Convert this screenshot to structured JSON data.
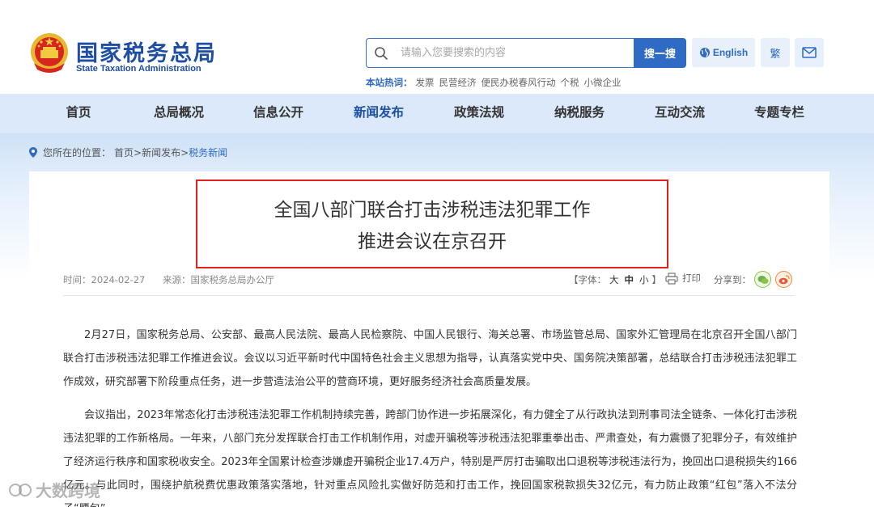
{
  "header": {
    "logo_cn": "国家税务总局",
    "logo_en": "State Taxation Administration",
    "search": {
      "placeholder": "请输入您要搜索的内容",
      "button": "搜一搜"
    },
    "english": "English",
    "traditional": "繁",
    "hot_label": "本站热词：",
    "hot_words": [
      "发票",
      "民营经济",
      "便民办税春风行动",
      "个税",
      "小微企业"
    ]
  },
  "nav": {
    "items": [
      "首页",
      "总局概况",
      "信息公开",
      "新闻发布",
      "政策法规",
      "纳税服务",
      "互动交流",
      "专题专栏"
    ],
    "active": "新闻发布"
  },
  "breadcrumb": {
    "label": "您所在的位置：",
    "items": [
      "首页",
      "新闻发布"
    ],
    "separator": ">",
    "current": "税务新闻"
  },
  "article": {
    "title_line1": "全国八部门联合打击涉税违法犯罪工作",
    "title_line2": "推进会议在京召开",
    "time": "时间：2024-02-27",
    "source": "来源：国家税务总局办公厅",
    "font_label": "【字体：",
    "font_large": "大",
    "font_medium": "中",
    "font_small": "小",
    "font_close": "】",
    "print": "打印",
    "share": "分享到：",
    "paragraphs": [
      "2月27日，国家税务总局、公安部、最高人民法院、最高人民检察院、中国人民银行、海关总署、市场监管总局、国家外汇管理局在北京召开全国八部门联合打击涉税违法犯罪工作推进会议。会议以习近平新时代中国特色社会主义思想为指导，认真落实党中央、国务院决策部署，总结联合打击涉税违法犯罪工作成效，研究部署下阶段重点任务，进一步营造法治公平的营商环境，更好服务经济社会高质量发展。",
      "会议指出，2023年常态化打击涉税违法犯罪工作机制持续完善，跨部门协作进一步拓展深化，有力健全了从行政执法到刑事司法全链条、一体化打击涉税违法犯罪的工作新格局。一年来，八部门充分发挥联合打击工作机制作用，对虚开骗税等涉税违法犯罪重拳出击、严肃查处，有力震慑了犯罪分子，有效维护了经济运行秩序和国家税收安全。2023年全国累计检查涉嫌虚开骗税企业17.4万户，特别是严厉打击骗取出口退税等涉税违法行为，挽回出口退税损失约166亿元。与此同时，围绕护航税费优惠政策落实落地，针对重点风险扎实做好防范和打击工作，挽回国家税款损失32亿元，有力防止政策“红包”落入不法分子“腰包”。"
    ]
  },
  "watermark": "大数跨境",
  "colors": {
    "brand": "#1d4ea3",
    "accent": "#2f6bc5",
    "highlight_border": "#e0221e",
    "nav_bg": "#dbe9fa"
  }
}
